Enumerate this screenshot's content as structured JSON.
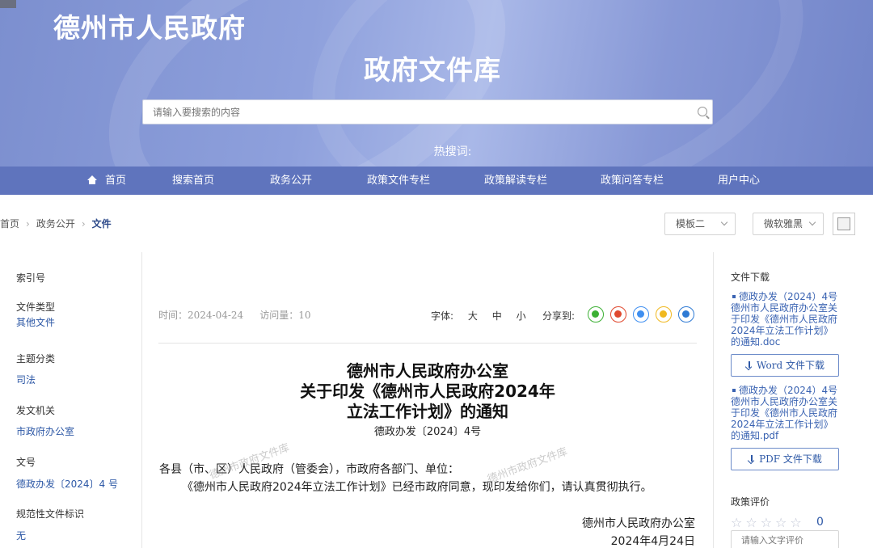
{
  "header": {
    "site_title": "德州市人民政府",
    "library_title": "政府文件库",
    "search_placeholder": "请输入要搜索的内容",
    "hot_words_label": "热搜词:"
  },
  "nav": {
    "items": [
      {
        "label": "首页",
        "icon": "home-icon"
      },
      {
        "label": "搜索首页"
      },
      {
        "label": "政务公开"
      },
      {
        "label": "政策文件专栏"
      },
      {
        "label": "政策解读专栏"
      },
      {
        "label": "政策问答专栏"
      },
      {
        "label": "用户中心"
      }
    ]
  },
  "breadcrumb": {
    "items": [
      "首页",
      "政务公开",
      "文件"
    ]
  },
  "toolbar": {
    "template_select": "模板二",
    "font_select": "微软雅黑"
  },
  "meta": {
    "index_no_label": "索引号",
    "index_no_value": "",
    "doc_type_label": "文件类型",
    "doc_type_value": "其他文件",
    "topic_label": "主题分类",
    "topic_value": "司法",
    "issuer_label": "发文机关",
    "issuer_value": "市政府办公室",
    "doc_no_label": "文号",
    "doc_no_value": "德政办发〔2024〕4 号",
    "normative_label": "规范性文件标识",
    "normative_value": "无"
  },
  "article": {
    "time_label": "时间：2024-04-24",
    "visits_label": "访问量：10",
    "font_label": "字体:",
    "font_large": "大",
    "font_medium": "中",
    "font_small": "小",
    "share_label": "分享到:",
    "title_line1": "德州市人民政府办公室",
    "title_line2": "关于印发《德州市人民政府2024年",
    "title_line3": "立法工作计划》的通知",
    "doc_number": "德政办发〔2024〕4号",
    "salutation": "各县（市、区）人民政府（管委会），市政府各部门、单位：",
    "body": "《德州市人民政府2024年立法工作计划》已经市政府同意，现印发给你们，请认真贯彻执行。",
    "sign_org": "德州市人民政府办公室",
    "sign_date": "2024年4月24日",
    "watermark": "德州市政府文件库"
  },
  "share_icons": [
    {
      "name": "wechat-icon",
      "color": "#3cb034"
    },
    {
      "name": "weibo-icon",
      "color": "#e0492f"
    },
    {
      "name": "qq-icon",
      "color": "#3f8ff0"
    },
    {
      "name": "qzone-icon",
      "color": "#f0b81f"
    },
    {
      "name": "tencent-weibo-icon",
      "color": "#2e7ad4"
    }
  ],
  "sidebar": {
    "download_title": "文件下载",
    "doc_link": "德政办发（2024）4号德州市人民政府办公室关于印发《德州市人民政府2024年立法工作计划》的通知.doc",
    "word_button": "Word 文件下载",
    "pdf_link": "德政办发（2024）4号德州市人民政府办公室关于印发《德州市人民政府2024年立法工作计划》的通知.pdf",
    "pdf_button": "PDF 文件下载",
    "rating_title": "政策评价",
    "rating_stars": "☆☆☆☆☆",
    "rating_count": "0",
    "comment_placeholder": "请输入文字评价"
  }
}
